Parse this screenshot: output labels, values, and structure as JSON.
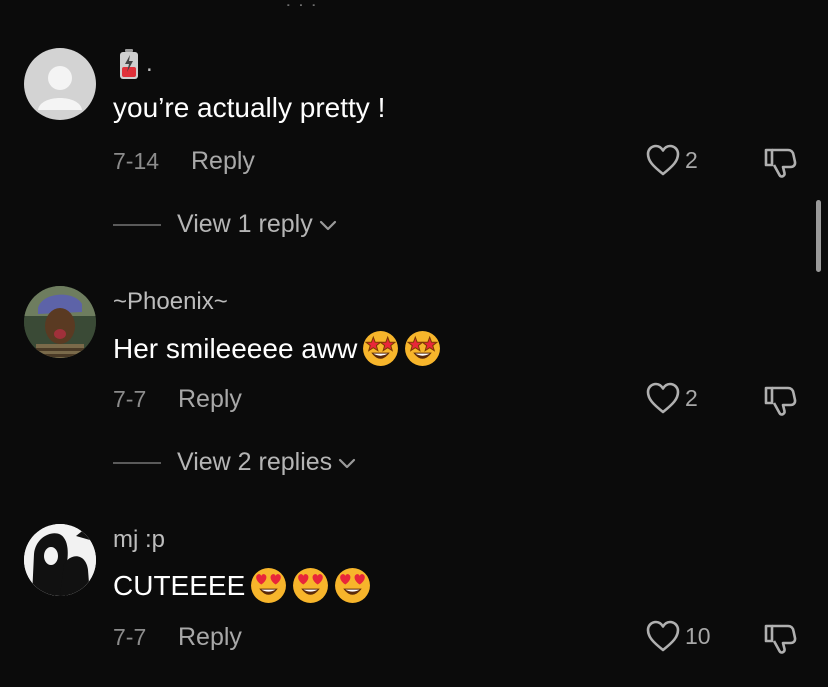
{
  "comments": [
    {
      "username": ".",
      "badge_icon": "battery-emoji-icon",
      "text": "you’re actually pretty !",
      "date": "7-14",
      "reply_label": "Reply",
      "likes": "2",
      "view_replies": "View 1 reply"
    },
    {
      "username": "~Phoenix~",
      "text": "Her smileeeee aww",
      "emojis": [
        "star-struck-emoji-icon",
        "star-struck-emoji-icon"
      ],
      "date": "7-7",
      "reply_label": "Reply",
      "likes": "2",
      "view_replies": "View 2 replies"
    },
    {
      "username": "mj :p",
      "text": "CUTEEEE",
      "emojis": [
        "heart-eyes-emoji-icon",
        "heart-eyes-emoji-icon",
        "heart-eyes-emoji-icon"
      ],
      "date": "7-7",
      "reply_label": "Reply",
      "likes": "10"
    }
  ],
  "colors": {
    "background": "#0b0b0b",
    "text_primary": "#ffffff",
    "text_secondary": "#a8a8a8",
    "emoji_yellow": "#f7b52b",
    "emoji_heart": "#e8263a"
  }
}
